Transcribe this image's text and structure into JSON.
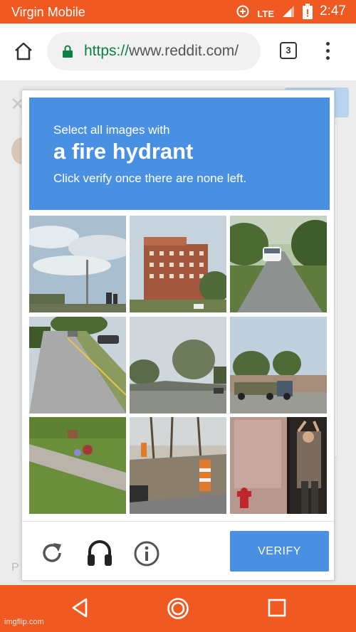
{
  "status_bar": {
    "carrier": "Virgin Mobile",
    "network": "LTE",
    "time": "2:47",
    "color": "#f05a22",
    "icons": [
      "data-saver-icon",
      "signal-icon",
      "battery-icon"
    ]
  },
  "browser": {
    "url_scheme": "https://",
    "url_host": "www.reddit.com/",
    "tab_count": "3",
    "icons": [
      "home-icon",
      "lock-icon",
      "menu-icon"
    ]
  },
  "page_behind": {
    "partial_letter": "P"
  },
  "captcha": {
    "prompt_line1": "Select all images with",
    "target": "a fire hydrant",
    "prompt_line3": "Click verify once there are none left.",
    "accent_color": "#4a90e2",
    "tiles": [
      "Sky over a street with a traffic light",
      "Brick apartment building",
      "Tree-lined road with a white car",
      "Road with parked cars",
      "Intersection with trees",
      "Vehicle towing a trailer",
      "Grass lawn with a sidewalk",
      "Sidewalk with orange traffic barrels",
      "Man dancing beside a red fire hydrant"
    ],
    "footer_icons": [
      "reload-icon",
      "headphones-icon",
      "info-icon"
    ],
    "verify_label": "VERIFY"
  },
  "nav_bar": {
    "icons": [
      "back-icon",
      "home-circle-icon",
      "recents-icon"
    ]
  },
  "watermark": "imgflip.com"
}
